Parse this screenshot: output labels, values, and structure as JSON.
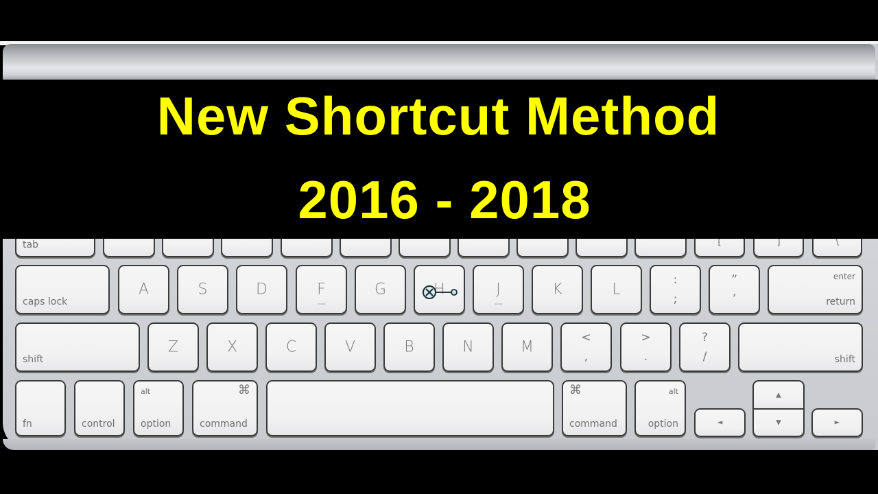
{
  "banner": {
    "line1": "New Shortcut Method",
    "line2": "2016 - 2018",
    "text_color": "#ffff00",
    "background_color": "#000000"
  },
  "keyboard": {
    "row1": {
      "tab": "tab",
      "bracket_left": "[",
      "bracket_right": "]",
      "backslash": "\\"
    },
    "row2": {
      "caps_lock": "caps lock",
      "letters": [
        "A",
        "S",
        "D",
        "F",
        "G",
        "H",
        "J",
        "K",
        "L"
      ],
      "semicolon_top": ":",
      "semicolon_bottom": ";",
      "quote_top": "”",
      "quote_bottom": "’",
      "return_top": "enter",
      "return_bottom": "return"
    },
    "row3": {
      "shift_left": "shift",
      "letters": [
        "Z",
        "X",
        "C",
        "V",
        "B",
        "N",
        "M"
      ],
      "comma_top": "<",
      "comma_bottom": ",",
      "period_top": ">",
      "period_bottom": ".",
      "slash_top": "?",
      "slash_bottom": "/",
      "shift_right": "shift"
    },
    "row4": {
      "fn": "fn",
      "control": "control",
      "option_left_top": "alt",
      "option_left": "option",
      "command_left_symbol": "⌘",
      "command_left": "command",
      "command_right_symbol": "⌘",
      "command_right": "command",
      "option_right_top": "alt",
      "option_right": "option",
      "arrow_up": "▲",
      "arrow_down": "▼",
      "arrow_left": "◄",
      "arrow_right": "►"
    }
  }
}
